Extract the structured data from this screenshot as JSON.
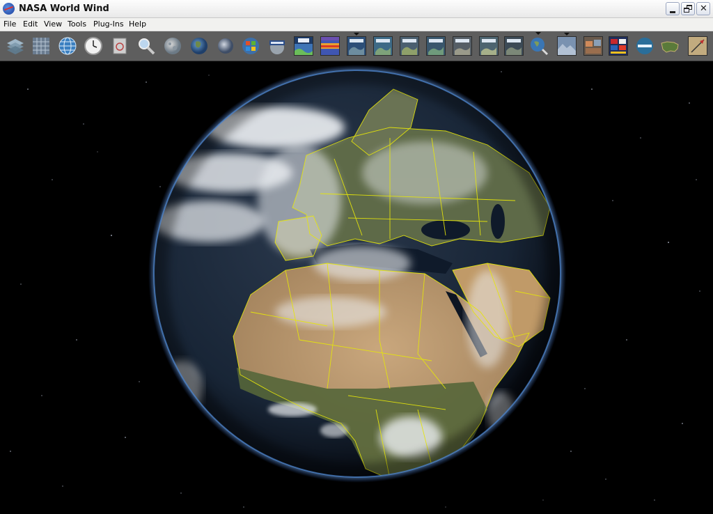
{
  "window": {
    "title": "NASA World Wind"
  },
  "menu": [
    {
      "label": "File"
    },
    {
      "label": "Edit"
    },
    {
      "label": "View"
    },
    {
      "label": "Tools"
    },
    {
      "label": "Plug-Ins"
    },
    {
      "label": "Help"
    }
  ],
  "toolbar": [
    {
      "icon": "layers-icon"
    },
    {
      "icon": "latlon-grid-icon"
    },
    {
      "icon": "globe-grid-icon"
    },
    {
      "icon": "clock-icon"
    },
    {
      "icon": "screenshot-icon"
    },
    {
      "icon": "magnifier-icon"
    },
    {
      "icon": "moon-icon"
    },
    {
      "icon": "earth-icon"
    },
    {
      "icon": "planet-icon"
    },
    {
      "icon": "windows-logo-icon"
    },
    {
      "icon": "modis-icon"
    },
    {
      "icon": "wms-icon"
    },
    {
      "icon": "temperature-map-icon"
    },
    {
      "icon": "landsat-layer-icon"
    },
    {
      "icon": "imagery-layer-icon"
    },
    {
      "icon": "imagery-layer-icon"
    },
    {
      "icon": "imagery-layer-icon"
    },
    {
      "icon": "imagery-layer-icon"
    },
    {
      "icon": "imagery-layer-icon"
    },
    {
      "icon": "imagery-layer-icon"
    },
    {
      "icon": "imagery-layer-icon"
    },
    {
      "icon": "globe-search-icon"
    },
    {
      "icon": "terrain-layer-icon"
    },
    {
      "icon": "city-layer-icon"
    },
    {
      "icon": "flags-icon"
    },
    {
      "icon": "placenames-icon"
    },
    {
      "icon": "usa-map-icon"
    },
    {
      "icon": "compass-icon"
    }
  ],
  "colors": {
    "titlebar": "#ececec",
    "menubar": "#f1f1ef",
    "toolbar": "#5e5e5e",
    "viewport": "#000000",
    "borders": "#e6e60a",
    "ocean": "#101a2c"
  }
}
